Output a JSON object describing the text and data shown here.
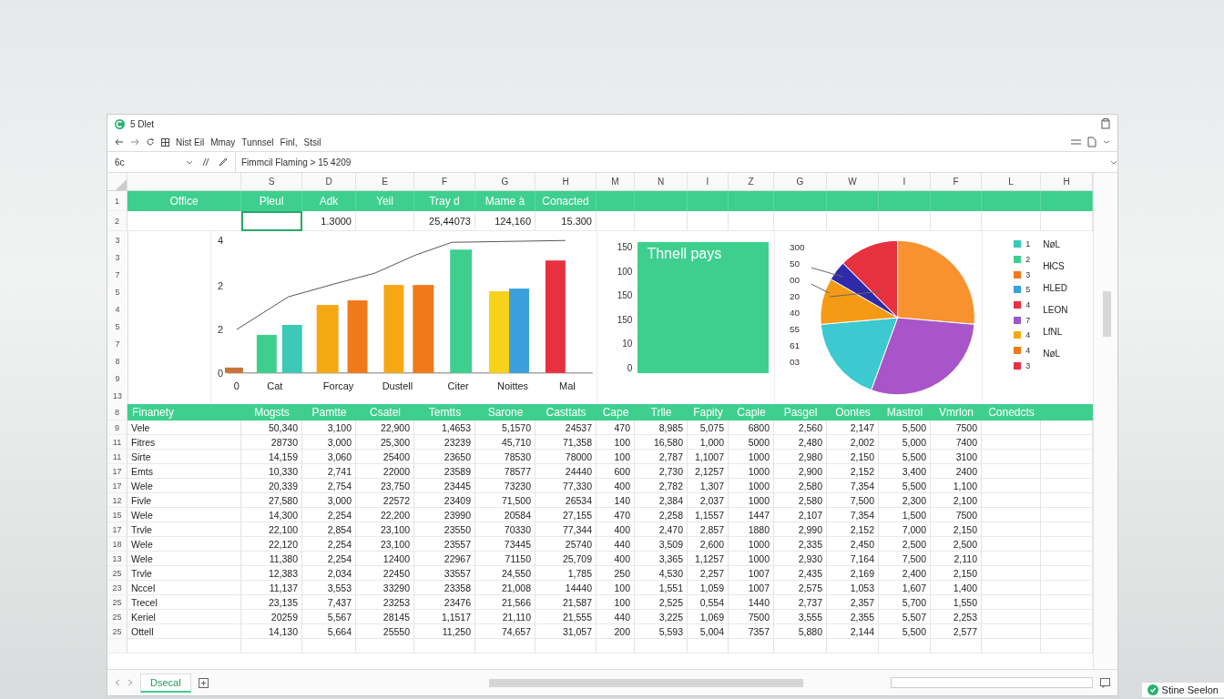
{
  "window": {
    "title": "5 Dlet"
  },
  "menu": [
    "Nist Eil",
    "Mmay",
    "Tunnsel",
    "Finl,",
    "Stsil"
  ],
  "formula_bar": {
    "cell_ref": "6c",
    "formula": "Fimmcil Flaming > 15 4209"
  },
  "column_headers": [
    "S",
    "D",
    "E",
    "F",
    "G",
    "H",
    "M",
    "N",
    "I",
    "Z",
    "G",
    "W",
    "I",
    "F",
    "L",
    "H"
  ],
  "row_1": {
    "number": "1",
    "cells": [
      "Office",
      "Pleul",
      "Adk",
      "Yeil",
      "Tray d",
      "Mame à",
      "Conacted"
    ]
  },
  "row_2": {
    "number": "2",
    "cells": [
      {
        "selected": false
      },
      {
        "selected": true
      },
      {
        "text": "1.3000",
        "selected": false
      },
      {
        "selected": false
      },
      {
        "text": "25,44073",
        "selected": false
      },
      {
        "text": "124,160",
        "selected": false
      },
      {
        "text": "15.300",
        "selected": false
      }
    ]
  },
  "chart_row_numbers": [
    "3",
    "3",
    "7",
    "5",
    "4",
    "5",
    "7",
    "8",
    "9",
    "13"
  ],
  "bar_chart": {
    "y_labels": [
      "4",
      "2",
      "2",
      "0"
    ],
    "x_labels": [
      "0",
      "Cat",
      "Forcay",
      "Dustell",
      "Citer",
      "Noittes",
      "Mal"
    ]
  },
  "panel": {
    "title": "Thnell pays",
    "axis_labels": [
      "150",
      "100",
      "150",
      "150",
      "10",
      "0"
    ]
  },
  "pie_chart": {
    "labels": [
      "300",
      "50",
      "00",
      "20",
      "40",
      "55",
      "61",
      "03"
    ]
  },
  "legend": {
    "items": [
      {
        "number": "1",
        "color": "#3cc9b8"
      },
      {
        "number": "2",
        "color": "#3ecf8e"
      },
      {
        "number": "3",
        "color": "#f07a1a"
      },
      {
        "number": "5",
        "color": "#3aa0dc"
      },
      {
        "number": "4",
        "color": "#e8313f"
      },
      {
        "number": "7",
        "color": "#9b59c9"
      },
      {
        "number": "4",
        "color": "#f5a814"
      },
      {
        "number": "4",
        "color": "#f07a1a"
      },
      {
        "number": "3",
        "color": "#e8313f"
      }
    ],
    "labels": [
      "NøL",
      "HłCS",
      "HLED",
      "LEON",
      "LfNL",
      "NøL"
    ]
  },
  "table": {
    "header_number": "8",
    "columns": [
      "Finanety",
      "Mogsts",
      "Pamtte",
      "Csatel",
      "Temtts",
      "Sarone",
      "Casttats",
      "Cape",
      "Trlle",
      "Fapity",
      "Caple",
      "Pasgel",
      "Oontes",
      "Mastrol",
      "Vmrlon",
      "Conedcts"
    ],
    "rows": [
      {
        "number": "9",
        "cells": [
          "Vele",
          "50,340",
          "3,100",
          "22,900",
          "1,4653",
          "5,1570",
          "24537",
          "470",
          "8,985",
          "5,075",
          "6800",
          "2,560",
          "2,147",
          "5,500",
          "7500"
        ]
      },
      {
        "number": "11",
        "cells": [
          "Fitres",
          "28730",
          "3,000",
          "25,300",
          "23239",
          "45,710",
          "71,358",
          "100",
          "16,580",
          "1,000",
          "5000",
          "2,480",
          "2,002",
          "5,000",
          "7400"
        ]
      },
      {
        "number": "11",
        "cells": [
          "Sirte",
          "14,159",
          "3,060",
          "25400",
          "23650",
          "78530",
          "78000",
          "100",
          "2,787",
          "1,1007",
          "1000",
          "2,980",
          "2,150",
          "5,500",
          "3100"
        ]
      },
      {
        "number": "17",
        "cells": [
          "Emts",
          "10,330",
          "2,741",
          "22000",
          "23589",
          "78577",
          "24440",
          "600",
          "2,730",
          "2,1257",
          "1000",
          "2,900",
          "2,152",
          "3,400",
          "2400"
        ]
      },
      {
        "number": "17",
        "cells": [
          "Wele",
          "20,339",
          "2,754",
          "23,750",
          "23445",
          "73230",
          "77,330",
          "400",
          "2,782",
          "1,307",
          "1000",
          "2,580",
          "7,354",
          "5,500",
          "1,100"
        ]
      },
      {
        "number": "12",
        "cells": [
          "Fivle",
          "27,580",
          "3,000",
          "22572",
          "23409",
          "71,500",
          "26534",
          "140",
          "2,384",
          "2,037",
          "1000",
          "2,580",
          "7,500",
          "2,300",
          "2,100"
        ]
      },
      {
        "number": "15",
        "cells": [
          "Wele",
          "14,300",
          "2,254",
          "22,200",
          "23990",
          "20584",
          "27,155",
          "470",
          "2,258",
          "1,1557",
          "1447",
          "2,107",
          "7,354",
          "1,500",
          "7500"
        ]
      },
      {
        "number": "17",
        "cells": [
          "Trvle",
          "22,100",
          "2,854",
          "23,100",
          "23550",
          "70330",
          "77,344",
          "400",
          "2,470",
          "2,857",
          "1880",
          "2,990",
          "2,152",
          "7,000",
          "2,150"
        ]
      },
      {
        "number": "18",
        "cells": [
          "Wele",
          "22,120",
          "2,254",
          "23,100",
          "23557",
          "73445",
          "25740",
          "440",
          "3,509",
          "2,600",
          "1000",
          "2,335",
          "2,450",
          "2,500",
          "2,500"
        ]
      },
      {
        "number": "13",
        "cells": [
          "Wele",
          "11,380",
          "2,254",
          "12400",
          "22967",
          "71150",
          "25,709",
          "400",
          "3,365",
          "1,1257",
          "1000",
          "2,930",
          "7,164",
          "7,500",
          "2,110"
        ]
      },
      {
        "number": "25",
        "cells": [
          "Trvle",
          "12,383",
          "2,034",
          "22450",
          "33557",
          "24,550",
          "1,785",
          "250",
          "4,530",
          "2,257",
          "1007",
          "2,435",
          "2,169",
          "2,400",
          "2,150"
        ]
      },
      {
        "number": "23",
        "cells": [
          "Nccel",
          "11,137",
          "3,553",
          "33290",
          "23358",
          "21,008",
          "14440",
          "100",
          "1,551",
          "1,059",
          "1007",
          "2,575",
          "1,053",
          "1,607",
          "1,400"
        ]
      },
      {
        "number": "25",
        "cells": [
          "Trecel",
          "23,135",
          "7,437",
          "23253",
          "23476",
          "21,566",
          "21,587",
          "100",
          "2,525",
          "0,554",
          "1440",
          "2,737",
          "2,357",
          "5,700",
          "1,550"
        ]
      },
      {
        "number": "25",
        "cells": [
          "Keriel",
          "20259",
          "5,567",
          "28145",
          "1,1517",
          "21,110",
          "21,555",
          "440",
          "3,225",
          "1,069",
          "7500",
          "3,555",
          "2,355",
          "5,507",
          "2,253"
        ]
      },
      {
        "number": "25",
        "cells": [
          "Ottell",
          "14,130",
          "5,664",
          "25550",
          "11,250",
          "74,657",
          "31,057",
          "200",
          "5,593",
          "5,004",
          "7357",
          "5,880",
          "2,144",
          "5,500",
          "2,577"
        ]
      }
    ]
  },
  "sheet_tabs": [
    {
      "label": "Dsecal",
      "selected": true
    }
  ],
  "badge": {
    "label": "Stine Seelon"
  }
}
